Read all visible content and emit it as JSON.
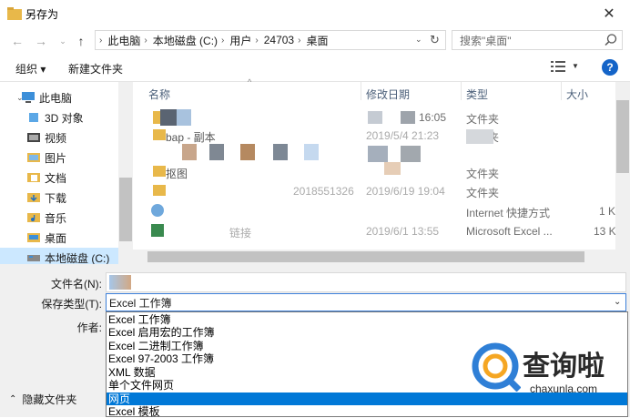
{
  "window": {
    "title": "另存为"
  },
  "breadcrumb": [
    "此电脑",
    "本地磁盘 (C:)",
    "用户",
    "24703",
    "桌面"
  ],
  "search": {
    "placeholder": "搜索\"桌面\""
  },
  "toolbar": {
    "organize": "组织 ▾",
    "new_folder": "新建文件夹"
  },
  "nav": {
    "items": [
      {
        "label": "此电脑",
        "icon": "computer-icon"
      },
      {
        "label": "3D 对象",
        "icon": "3d-objects-icon"
      },
      {
        "label": "视频",
        "icon": "video-icon"
      },
      {
        "label": "图片",
        "icon": "pictures-icon"
      },
      {
        "label": "文档",
        "icon": "documents-icon"
      },
      {
        "label": "下载",
        "icon": "download-icon"
      },
      {
        "label": "音乐",
        "icon": "music-icon"
      },
      {
        "label": "桌面",
        "icon": "desktop-icon"
      },
      {
        "label": "本地磁盘 (C:)",
        "icon": "drive-icon"
      }
    ]
  },
  "columns": {
    "name": "名称",
    "modified": "修改日期",
    "type": "类型",
    "size": "大小"
  },
  "files": [
    {
      "name": "",
      "modified": "16:05",
      "type": "文件夹",
      "size": ""
    },
    {
      "name": "bap - 副本",
      "modified": "2019/5/4 21:23",
      "type": "文件夹",
      "size": ""
    },
    {
      "name": "",
      "modified": "",
      "type": "文件夹",
      "size": ""
    },
    {
      "name": "抠图",
      "modified": "",
      "type": "文件夹",
      "size": ""
    },
    {
      "name": "2018551326",
      "modified": "2019/6/19 19:04",
      "type": "文件夹",
      "size": ""
    },
    {
      "name": "",
      "modified": "",
      "type": "Internet 快捷方式",
      "size": "1 K"
    },
    {
      "name": "链接",
      "modified": "2019/6/1 13:55",
      "type": "Microsoft Excel ...",
      "size": "13 K"
    }
  ],
  "form": {
    "filename_label": "文件名(N):",
    "filetype_label": "保存类型(T):",
    "author_label": "作者:",
    "filename_value": "",
    "filetype_value": "Excel 工作簿"
  },
  "filetype_options": [
    "Excel 工作簿",
    "Excel 启用宏的工作簿",
    "Excel 二进制工作簿",
    "Excel 97-2003 工作簿",
    "XML 数据",
    "单个文件网页",
    "网页",
    "Excel 模板"
  ],
  "highlighted_option": "网页",
  "hide_folders": "隐藏文件夹",
  "watermark": {
    "text": "查询啦",
    "sub": "chaxunla.com"
  }
}
